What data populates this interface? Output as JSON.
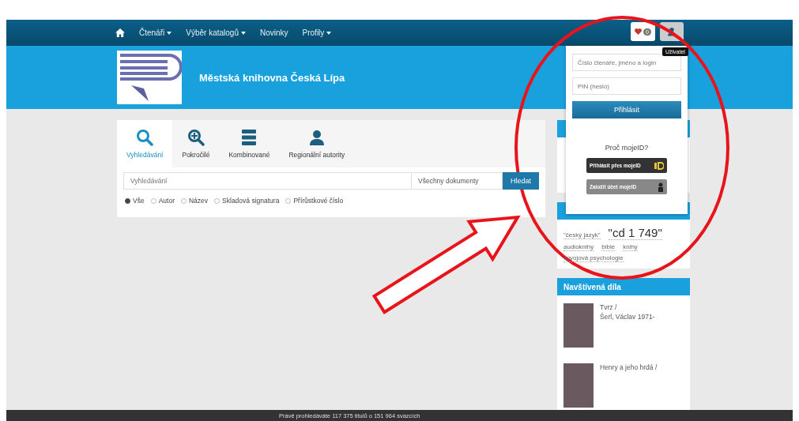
{
  "navbar": {
    "items": [
      {
        "label": "Čtenáři",
        "dropdown": true
      },
      {
        "label": "Výběr katalogů",
        "dropdown": true
      },
      {
        "label": "Novinky",
        "dropdown": false
      },
      {
        "label": "Profily",
        "dropdown": true
      }
    ],
    "favorites_count": "0",
    "user_tooltip": "Uživatel"
  },
  "header": {
    "title": "Městská knihovna Česká Lípa"
  },
  "search": {
    "tabs": [
      {
        "label": "Vyhledávání",
        "selected": true,
        "kind": "search"
      },
      {
        "label": "Pokročilé",
        "selected": false,
        "kind": "advanced"
      },
      {
        "label": "Kombinované",
        "selected": false,
        "kind": "combined"
      },
      {
        "label": "Regionální autority",
        "selected": false,
        "kind": "person"
      }
    ],
    "placeholder": "Vyhledávání",
    "scope": "Všechny dokumenty",
    "button": "Hledat",
    "fields": [
      {
        "label": "Vše",
        "selected": true
      },
      {
        "label": "Autor",
        "selected": false
      },
      {
        "label": "Název",
        "selected": false
      },
      {
        "label": "Skladová signatura",
        "selected": false
      },
      {
        "label": "Přírůstkové číslo",
        "selected": false
      }
    ]
  },
  "login": {
    "user_placeholder": "Číslo čtenáře, jméno a login",
    "password_placeholder": "PIN (heslo)",
    "submit": "Přihlásit",
    "mojeid_question": "Proč mojeID?",
    "mojeid_login": "Přihlásit přes mojeID",
    "mojeid_register": "Založit účet mojeID"
  },
  "tag_cloud": [
    {
      "label": "\"český jazyk\"",
      "kind": "small"
    },
    {
      "label": "\"cd 1 749\"",
      "kind": "large"
    },
    {
      "label": "audioknihy",
      "kind": "small"
    },
    {
      "label": "bible",
      "kind": "small"
    },
    {
      "label": "knihy",
      "kind": "small"
    },
    {
      "label": "vývojová psychologie",
      "kind": "small"
    }
  ],
  "visited": {
    "title": "Navštívená díla",
    "items": [
      {
        "title": "Tvrz /",
        "author": "Šerl, Václav 1971-"
      },
      {
        "title": "Henry a jeho hrdá /"
      }
    ]
  },
  "footer": {
    "text": "Právě prohledáváte 117 375 titulů o 151 964 svazcích"
  }
}
